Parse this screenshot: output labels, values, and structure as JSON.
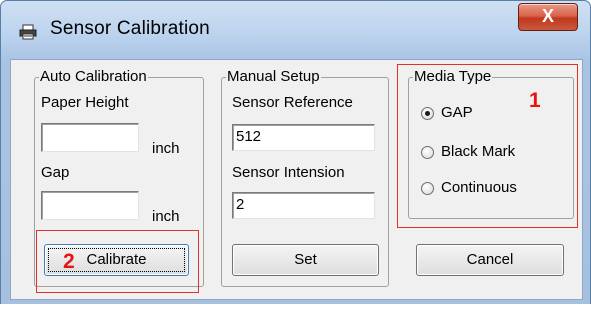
{
  "window": {
    "title": "Sensor Calibration",
    "close_label": "X",
    "icon": "printer-icon"
  },
  "auto_calibration": {
    "label": "Auto Calibration",
    "paper_height_label": "Paper Height",
    "paper_height_value": "",
    "paper_height_unit": "inch",
    "gap_label": "Gap",
    "gap_value": "",
    "gap_unit": "inch",
    "calibrate_label": "Calibrate"
  },
  "manual_setup": {
    "label": "Manual Setup",
    "sensor_reference_label": "Sensor Reference",
    "sensor_reference_value": "512",
    "sensor_intension_label": "Sensor Intension",
    "sensor_intension_value": "2",
    "set_label": "Set"
  },
  "media_type": {
    "label": "Media Type",
    "options": [
      {
        "label": "GAP",
        "checked": true
      },
      {
        "label": "Black Mark",
        "checked": false
      },
      {
        "label": "Continuous",
        "checked": false
      }
    ]
  },
  "cancel_label": "Cancel",
  "annotations": {
    "one": "1",
    "two": "2",
    "color": "#e8140f"
  }
}
